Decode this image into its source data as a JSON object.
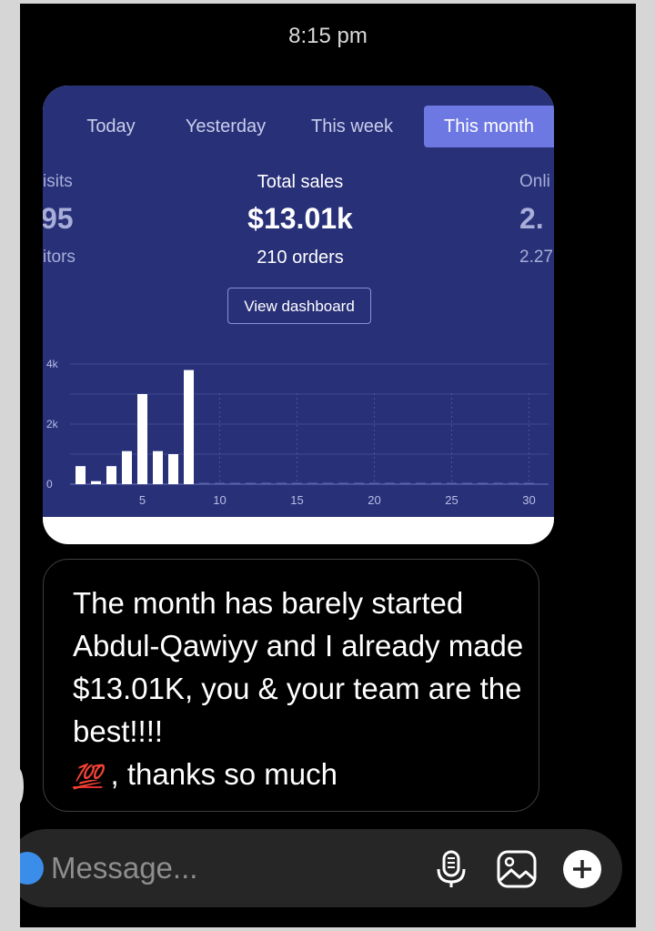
{
  "status": {
    "time": "8:15 pm"
  },
  "analytics": {
    "tabs": [
      "Today",
      "Yesterday",
      "This week",
      "This month"
    ],
    "active_tab": "This month",
    "left_stat": {
      "label": "isits",
      "value": "95",
      "sub": "itors"
    },
    "main_stat": {
      "label": "Total sales",
      "value": "$13.01k",
      "sub": "210 orders"
    },
    "right_stat": {
      "label": "Onli",
      "value": "2.",
      "sub": "2.27"
    },
    "view_button": "View dashboard"
  },
  "chart_data": {
    "type": "bar",
    "x": [
      1,
      2,
      3,
      4,
      5,
      6,
      7,
      8,
      9,
      10,
      11,
      12,
      13,
      14,
      15,
      16,
      17,
      18,
      19,
      20,
      21,
      22,
      23,
      24,
      25,
      26,
      27,
      28,
      29,
      30
    ],
    "values": [
      600,
      100,
      600,
      1100,
      3000,
      1100,
      1000,
      3800,
      0,
      0,
      0,
      0,
      0,
      0,
      0,
      0,
      0,
      0,
      0,
      0,
      0,
      0,
      0,
      0,
      0,
      0,
      0,
      0,
      0,
      0
    ],
    "y_ticks": [
      "0",
      "2k",
      "4k"
    ],
    "x_ticks": [
      "5",
      "10",
      "15",
      "20",
      "25",
      "30"
    ],
    "ylim": [
      0,
      4000
    ],
    "bar_color": "#ffffff",
    "grid": true
  },
  "message": {
    "text": "The month has barely started Abdul-Qawiyy and I already made $13.01K, you & your team are the best!!!!",
    "emoji": "💯",
    "tail": ", thanks so much"
  },
  "composer": {
    "placeholder": "Message..."
  }
}
